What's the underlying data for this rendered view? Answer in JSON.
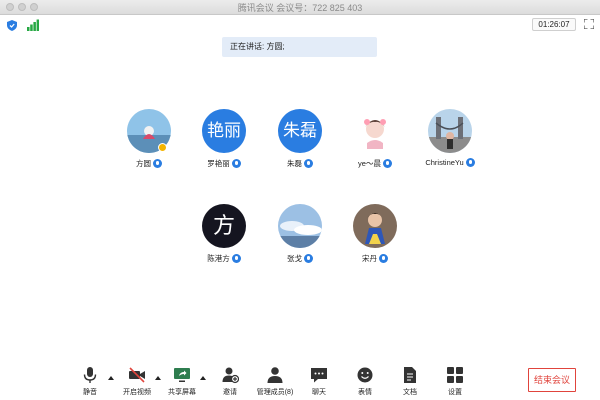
{
  "window": {
    "title": "腾讯会议 会议号：722 825 403"
  },
  "status": {
    "timer": "01:26:07",
    "speaking_label": "正在讲话: 方圆;"
  },
  "participants": [
    {
      "name": "方圆",
      "avatar_text": "",
      "host": true
    },
    {
      "name": "罗艳丽",
      "avatar_text": "艳丽",
      "host": false
    },
    {
      "name": "朱磊",
      "avatar_text": "朱磊",
      "host": false
    },
    {
      "name": "ye～晨",
      "avatar_text": "",
      "host": false
    },
    {
      "name": "ChristineYu",
      "avatar_text": "",
      "host": false
    },
    {
      "name": "陈港方",
      "avatar_text": "方",
      "host": false
    },
    {
      "name": "张戈",
      "avatar_text": "",
      "host": false
    },
    {
      "name": "宋丹",
      "avatar_text": "",
      "host": false
    }
  ],
  "toolbar": {
    "mute": "静音",
    "video": "开启视频",
    "share": "共享屏幕",
    "invite": "邀请",
    "members": "管理成员(8)",
    "chat": "聊天",
    "emoji": "表情",
    "docs": "文档",
    "settings": "设置",
    "end": "结束会议"
  },
  "colors": {
    "accent": "#2a7de1",
    "danger": "#e0443c",
    "speaking_bg": "#e3ecf8"
  }
}
